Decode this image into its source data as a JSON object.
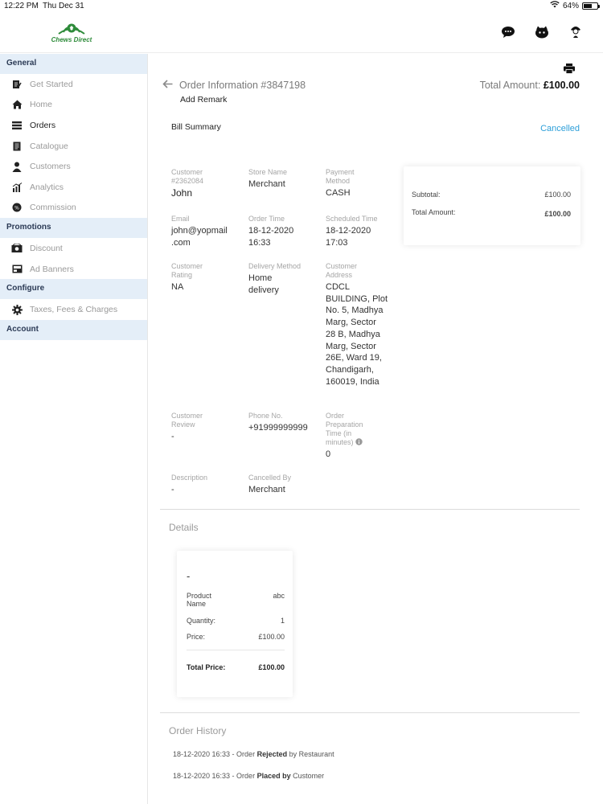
{
  "statusbar": {
    "time": "12:22 PM",
    "date": "Thu Dec 31",
    "battery": "64%",
    "battery_level": 0.64
  },
  "brand": {
    "name": "Chews Direct",
    "color": "#2e8b3a"
  },
  "header_icons": [
    "support-chat-icon",
    "profile-icon",
    "user-avatar-icon"
  ],
  "sidebar": {
    "sections": [
      {
        "title": "General",
        "items": [
          {
            "label": "Get Started",
            "icon": "checklist-icon"
          },
          {
            "label": "Home",
            "icon": "home-icon"
          },
          {
            "label": "Orders",
            "icon": "orders-icon"
          },
          {
            "label": "Catalogue",
            "icon": "catalogue-icon"
          },
          {
            "label": "Customers",
            "icon": "customers-icon"
          },
          {
            "label": "Analytics",
            "icon": "analytics-icon"
          },
          {
            "label": "Commission",
            "icon": "commission-icon"
          }
        ]
      },
      {
        "title": "Promotions",
        "items": [
          {
            "label": "Discount",
            "icon": "discount-icon"
          },
          {
            "label": "Ad Banners",
            "icon": "ad-banners-icon"
          }
        ]
      },
      {
        "title": "Configure",
        "items": [
          {
            "label": "Taxes, Fees & Charges",
            "icon": "gear-icon"
          }
        ]
      },
      {
        "title": "Account",
        "items": []
      }
    ],
    "active_item": "Orders",
    "highlight_color": "#e4eef8"
  },
  "order": {
    "title": "Order Information #3847198",
    "total_label": "Total Amount:",
    "total_value": "£100.00",
    "add_remark": "Add Remark",
    "bill_summary": "Bill Summary",
    "status": "Cancelled",
    "status_color": "#2d9fd9"
  },
  "fields": {
    "customer": {
      "label": "Customer #2362084",
      "value": "John"
    },
    "store": {
      "label": "Store Name",
      "value": "Merchant"
    },
    "payment": {
      "label": "Payment Method",
      "value": "CASH"
    },
    "email": {
      "label": "Email",
      "value": "john@yopmail .com"
    },
    "order_time": {
      "label": "Order Time",
      "value": "18-12-2020 16:33"
    },
    "scheduled_time": {
      "label": "Scheduled Time",
      "value": "18-12-2020 17:03"
    },
    "rating": {
      "label": "Customer Rating",
      "value": "NA"
    },
    "delivery": {
      "label": "Delivery Method",
      "value": "Home delivery"
    },
    "address": {
      "label": "Customer Address",
      "value": "CDCL BUILDING, Plot No. 5, Madhya Marg, Sector 28 B, Madhya Marg, Sector 26E, Ward 19, Chandigarh, 160019, India"
    },
    "review": {
      "label": "Customer Review",
      "value": "-"
    },
    "phone": {
      "label": "Phone No.",
      "value": "+91999999999"
    },
    "prep_time": {
      "label": "Order Preparation Time (in minutes)",
      "value": "0"
    },
    "description": {
      "label": "Description",
      "value": "-"
    },
    "cancelled_by": {
      "label": "Cancelled By",
      "value": "Merchant"
    }
  },
  "summary": {
    "subtotal_label": "Subtotal:",
    "subtotal_value": "£100.00",
    "total_label": "Total Amount:",
    "total_value": "£100.00"
  },
  "details": {
    "title": "Details",
    "product": {
      "heading": "-",
      "name_label": "Product Name",
      "name_value": "abc",
      "qty_label": "Quantity:",
      "qty_value": "1",
      "price_label": "Price:",
      "price_value": "£100.00",
      "total_label": "Total Price:",
      "total_value": "£100.00"
    }
  },
  "history": {
    "title": "Order History",
    "entries": [
      {
        "time": "18-12-2020 16:33 - Order ",
        "action": "Rejected",
        "by_text": " by Restaurant"
      },
      {
        "time": "18-12-2020 16:33 - Order ",
        "action": "Placed by",
        "by_text": " Customer"
      }
    ]
  }
}
